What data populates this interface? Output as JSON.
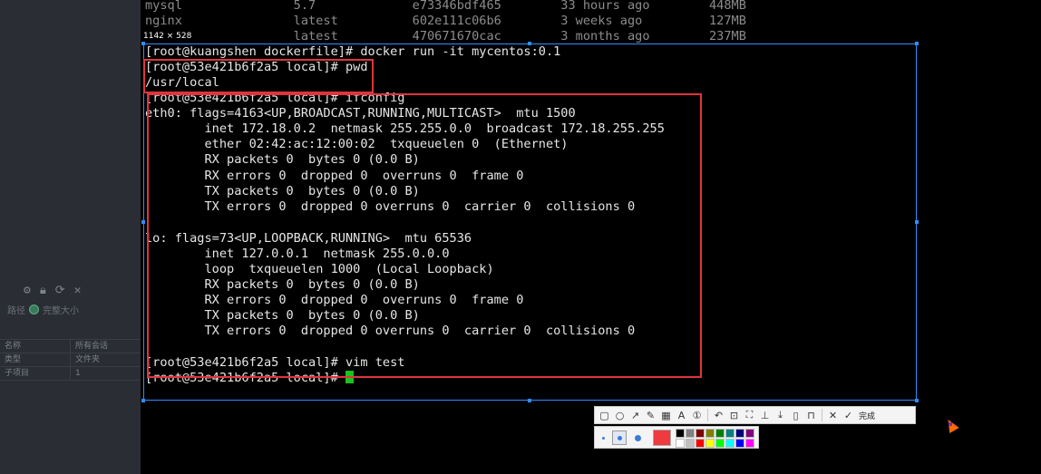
{
  "left_panel": {
    "icons": [
      "gear-icon",
      "lock-icon",
      "refresh-icon",
      "close-icon"
    ],
    "radio_options": [
      "路径",
      "完整大小"
    ],
    "table": [
      {
        "key": "名称",
        "value": "所有会话"
      },
      {
        "key": "类型",
        "value": "文件夹"
      },
      {
        "key": "子项目",
        "value": "1"
      }
    ]
  },
  "screenshot_tool": {
    "dimension_label": "1142 × 528",
    "toolbar_done_label": "完成",
    "tool_icons": [
      "rectangle-icon",
      "ellipse-icon",
      "arrow-icon",
      "pen-icon",
      "mosaic-icon",
      "text-icon",
      "serial-number-icon",
      "undo-icon",
      "ocr-icon",
      "scan-icon",
      "pin-icon",
      "save-icon",
      "copy-icon",
      "bookmark-icon",
      "close-icon",
      "check-icon"
    ],
    "current_color": "#ef3a3f",
    "palette": [
      "#000000",
      "#808080",
      "#800000",
      "#808000",
      "#008000",
      "#008080",
      "#000080",
      "#800080",
      "#ffffff",
      "#c0c0c0",
      "#ff0000",
      "#ffff00",
      "#00ff00",
      "#00ffff",
      "#0000ff",
      "#ff00ff"
    ]
  },
  "terminal": {
    "lines": [
      "mysql               5.7             e73346bdf465        33 hours ago        448MB",
      "nginx               latest          602e111c06b6        3 weeks ago         127MB",
      "                    latest          470671670cac        3 months ago        237MB",
      "[root@kuangshen dockerfile]# docker run -it mycentos:0.1",
      "[root@53e421b6f2a5 local]# pwd",
      "/usr/local",
      "[root@53e421b6f2a5 local]# ifconfig",
      "eth0: flags=4163<UP,BROADCAST,RUNNING,MULTICAST>  mtu 1500",
      "        inet 172.18.0.2  netmask 255.255.0.0  broadcast 172.18.255.255",
      "        ether 02:42:ac:12:00:02  txqueuelen 0  (Ethernet)",
      "        RX packets 0  bytes 0 (0.0 B)",
      "        RX errors 0  dropped 0  overruns 0  frame 0",
      "        TX packets 0  bytes 0 (0.0 B)",
      "        TX errors 0  dropped 0 overruns 0  carrier 0  collisions 0",
      "",
      "lo: flags=73<UP,LOOPBACK,RUNNING>  mtu 65536",
      "        inet 127.0.0.1  netmask 255.0.0.0",
      "        loop  txqueuelen 1000  (Local Loopback)",
      "        RX packets 0  bytes 0 (0.0 B)",
      "        RX errors 0  dropped 0  overruns 0  frame 0",
      "        TX packets 0  bytes 0 (0.0 B)",
      "        TX errors 0  dropped 0 overruns 0  carrier 0  collisions 0",
      "",
      "[root@53e421b6f2a5 local]# vim test",
      "[root@53e421b6f2a5 local]# "
    ],
    "cursor_color": "#19c21f"
  },
  "colors": {
    "selection_border": "#2f8cff",
    "annotation_red": "#e0343c",
    "terminal_bg": "#000000"
  }
}
